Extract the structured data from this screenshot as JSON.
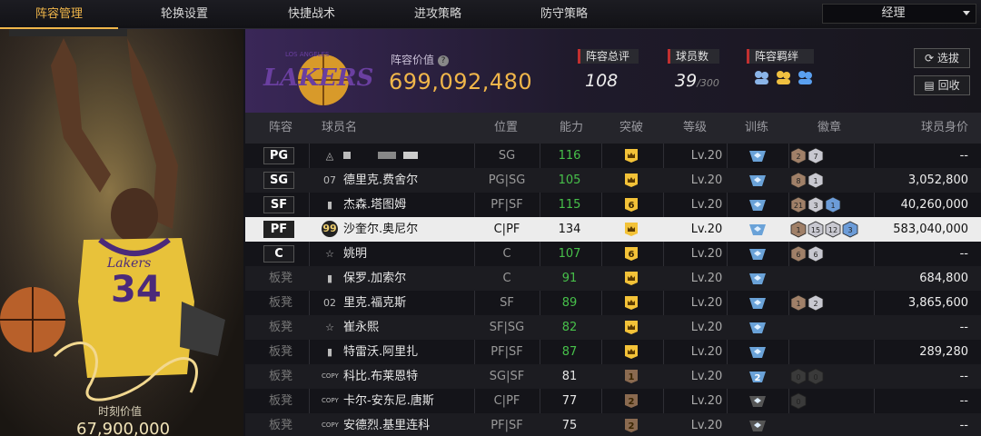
{
  "nav": {
    "tabs": [
      "阵容管理",
      "轮换设置",
      "快捷战术",
      "进攻策略",
      "防守策略"
    ],
    "active_tab": 0,
    "role_select": "经理"
  },
  "player_card": {
    "jersey": "34",
    "team_text": "Lakers",
    "value_label": "时刻价值",
    "value": "67,900,000"
  },
  "team_header": {
    "logo_text": "LAKERS",
    "logo_city": "LOS ANGELES",
    "lineup_value_label": "阵容价值",
    "lineup_value": "699,092,480",
    "rating_label": "阵容总评",
    "rating": "108",
    "players_label": "球员数",
    "players": "39",
    "players_max": "/300",
    "bond_label": "阵容羁绊",
    "select_button": "选拔",
    "recycle_button": "回收"
  },
  "table": {
    "headers": [
      "阵容",
      "球员名",
      "位置",
      "能力",
      "突破",
      "等级",
      "训练",
      "徽章",
      "球员身价"
    ],
    "rows": [
      {
        "slot": "PG",
        "starter": true,
        "num": "",
        "name": "",
        "pos": "SG",
        "ability": "116",
        "green": true,
        "brk": "crown",
        "lv": "Lv.20",
        "train": "",
        "badges": [
          [
            "2",
            "bronze"
          ],
          [
            "7",
            "silver"
          ]
        ],
        "price": "--"
      },
      {
        "slot": "SG",
        "starter": true,
        "num": "07",
        "name": "德里克.费舍尔",
        "pos": "PG|SG",
        "ability": "105",
        "green": true,
        "brk": "crown",
        "lv": "Lv.20",
        "train": "",
        "badges": [
          [
            "8",
            "bronze"
          ],
          [
            "1",
            "silver"
          ]
        ],
        "price": "3,052,800"
      },
      {
        "slot": "SF",
        "starter": true,
        "num": "",
        "name": "杰森.塔图姆",
        "pos": "PF|SF",
        "ability": "115",
        "green": true,
        "brk": "6",
        "lv": "Lv.20",
        "train": "",
        "badges": [
          [
            "21",
            "bronze"
          ],
          [
            "3",
            "silver"
          ],
          [
            "1",
            "blue"
          ]
        ],
        "price": "40,260,000"
      },
      {
        "slot": "PF",
        "starter": true,
        "num": "99",
        "name": "沙奎尔.奥尼尔",
        "pos": "C|PF",
        "ability": "134",
        "green": false,
        "brk": "crown",
        "lv": "Lv.20",
        "train": "",
        "badges": [
          [
            "1",
            "bronze"
          ],
          [
            "15",
            "silver"
          ],
          [
            "12",
            "silver"
          ],
          [
            "3",
            "blue"
          ]
        ],
        "price": "583,040,000"
      },
      {
        "slot": "C",
        "starter": true,
        "num": "",
        "name": "姚明",
        "pos": "C",
        "ability": "107",
        "green": true,
        "brk": "6",
        "lv": "Lv.20",
        "train": "",
        "badges": [
          [
            "6",
            "bronze"
          ],
          [
            "6",
            "silver"
          ]
        ],
        "price": "--"
      },
      {
        "slot": "板凳",
        "starter": false,
        "num": "",
        "name": "保罗.加索尔",
        "pos": "C",
        "ability": "91",
        "green": true,
        "brk": "crown",
        "lv": "Lv.20",
        "train": "",
        "badges": [],
        "price": "684,800"
      },
      {
        "slot": "板凳",
        "starter": false,
        "num": "02",
        "name": "里克.福克斯",
        "pos": "SF",
        "ability": "89",
        "green": true,
        "brk": "crown",
        "lv": "Lv.20",
        "train": "",
        "badges": [
          [
            "1",
            "bronze"
          ],
          [
            "2",
            "silver"
          ]
        ],
        "price": "3,865,600"
      },
      {
        "slot": "板凳",
        "starter": false,
        "num": "",
        "name": "崔永熙",
        "pos": "SF|SG",
        "ability": "82",
        "green": true,
        "brk": "crown",
        "lv": "Lv.20",
        "train": "",
        "badges": [],
        "price": "--"
      },
      {
        "slot": "板凳",
        "starter": false,
        "num": "",
        "name": "特雷沃.阿里扎",
        "pos": "PF|SF",
        "ability": "87",
        "green": true,
        "brk": "crown",
        "lv": "Lv.20",
        "train": "",
        "badges": [],
        "price": "289,280"
      },
      {
        "slot": "板凳",
        "starter": false,
        "num": "COPY",
        "name": "科比.布莱恩特",
        "pos": "SG|SF",
        "ability": "81",
        "green": false,
        "brk": "1",
        "lv": "Lv.20",
        "train": "2",
        "badges": [
          [
            "0",
            "dark"
          ],
          [
            "0",
            "dark"
          ]
        ],
        "price": "--"
      },
      {
        "slot": "板凳",
        "starter": false,
        "num": "COPY",
        "name": "卡尔-安东尼.唐斯",
        "pos": "C|PF",
        "ability": "77",
        "green": false,
        "brk": "2",
        "lv": "Lv.20",
        "train": "dark",
        "badges": [
          [
            "0",
            "dark"
          ]
        ],
        "price": "--"
      },
      {
        "slot": "板凳",
        "starter": false,
        "num": "COPY",
        "name": "安德烈.基里连科",
        "pos": "PF|SF",
        "ability": "75",
        "green": false,
        "brk": "2",
        "lv": "Lv.20",
        "train": "dark",
        "badges": [],
        "price": "--"
      }
    ]
  },
  "colors": {
    "accent": "#f0b64a",
    "ability_green": "#47c04a",
    "highlight_row": "#ececec",
    "bronze": "#a08068",
    "silver": "#c8c8d0",
    "blue": "#6c9cd8"
  }
}
